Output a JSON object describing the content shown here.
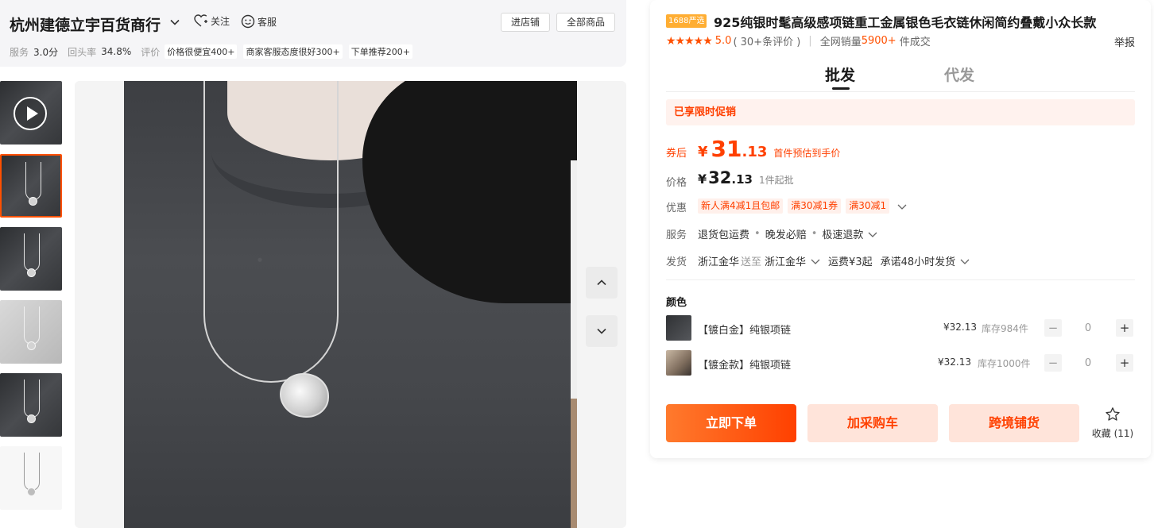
{
  "shop": {
    "name": "杭州建德立宇百货商行",
    "follow_label": "关注",
    "service_label": "客服",
    "enter_store_label": "进店铺",
    "all_products_label": "全部商品",
    "stats": {
      "service_key": "服务",
      "service_value": "3.0分",
      "repurchase_key": "回头率",
      "repurchase_value": "34.8%",
      "review_key": "评价",
      "tags": [
        "价格很便宜400+",
        "商家客服态度很好300+",
        "下单推荐200+"
      ]
    }
  },
  "gallery": {
    "thumbnails": [
      {
        "kind": "video",
        "icon": "play-icon"
      },
      {
        "kind": "photo"
      },
      {
        "kind": "photo"
      },
      {
        "kind": "photo"
      },
      {
        "kind": "photo"
      },
      {
        "kind": "photo"
      }
    ],
    "active_index": 1,
    "nav_up_icon": "chevron-up-icon",
    "nav_down_icon": "chevron-down-icon"
  },
  "product": {
    "badge": "1688严选",
    "title": "925纯银时髦高级感项链重工金属银色毛衣链休闲简约叠戴小众长款",
    "stars_icon": "star-icon",
    "rating": "5.0",
    "review_count": "( 30+条评价 )",
    "sales_label": "全网销量",
    "sales_value": "5900+",
    "sales_suffix": "件成交",
    "report_label": "举报"
  },
  "tabs": {
    "wholesale": "批发",
    "dropship": "代发"
  },
  "promo": {
    "label": "已享限时促销"
  },
  "pricing": {
    "after_coupon_label": "券后",
    "currency": "¥",
    "after_coupon_int": "31",
    "after_coupon_dec": ".13",
    "after_coupon_note": "首件预估到手价",
    "price_label": "价格",
    "price_int": "32",
    "price_dec": ".13",
    "min_order": "1件起批"
  },
  "discounts": {
    "label": "优惠",
    "coupons": [
      "新人满4减1且包邮",
      "满30减1券",
      "满30减1"
    ]
  },
  "services": {
    "label": "服务",
    "items": [
      "退货包运费",
      "晚发必赔",
      "极速退款"
    ]
  },
  "shipping": {
    "label": "发货",
    "from": "浙江金华",
    "to_label": "送至",
    "to": "浙江金华",
    "fee": "运费¥3起",
    "promise": "承诺48小时发货"
  },
  "skus": {
    "title": "颜色",
    "items": [
      {
        "name": "【镀白金】纯银项链",
        "price": "¥32.13",
        "stock": "库存984件",
        "qty": "0"
      },
      {
        "name": "【镀金款】纯银项链",
        "price": "¥32.13",
        "stock": "库存1000件",
        "qty": "0"
      }
    ],
    "minus": "−",
    "plus": "+"
  },
  "actions": {
    "buy_now": "立即下单",
    "add_cart": "加采购车",
    "cross_border": "跨境铺货",
    "favorite_label": "收藏",
    "favorite_count": "(11)"
  },
  "colors": {
    "accent": "#ff4000",
    "accent_light": "#ffe4da",
    "badge": "#ffae33"
  }
}
